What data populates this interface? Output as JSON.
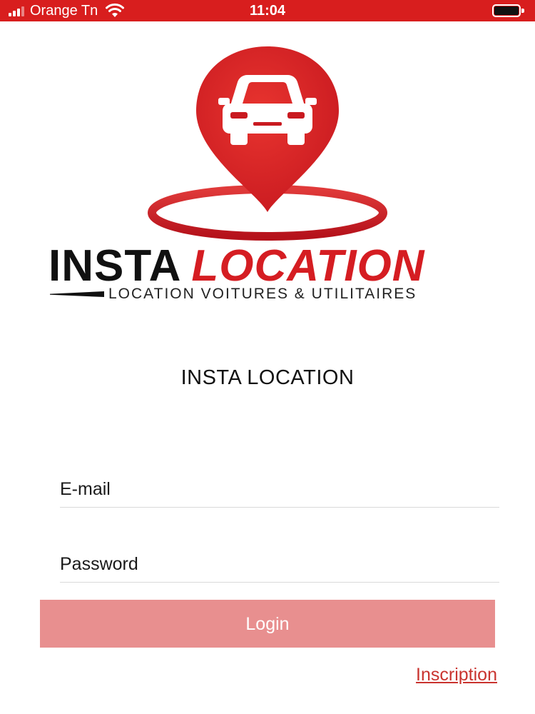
{
  "status_bar": {
    "carrier": "Orange Tn",
    "time": "11:04",
    "background_color": "#d81e1e",
    "signal_icon": "cellular-signal-icon",
    "wifi_icon": "wifi-icon",
    "battery_icon": "battery-icon"
  },
  "logo": {
    "icon": "car-location-pin-icon",
    "brand_primary": "INSTA",
    "brand_secondary": "LOCATION",
    "tagline": "LOCATION VOITURES & UTILITAIRES",
    "brand_color": "#d51d22"
  },
  "app": {
    "title": "INSTA LOCATION"
  },
  "form": {
    "email_placeholder": "E-mail",
    "email_value": "",
    "password_placeholder": "Password",
    "password_value": "",
    "login_label": "Login",
    "login_color": "#e88f8f",
    "inscription_label": "Inscription",
    "link_color": "#c9342f"
  }
}
